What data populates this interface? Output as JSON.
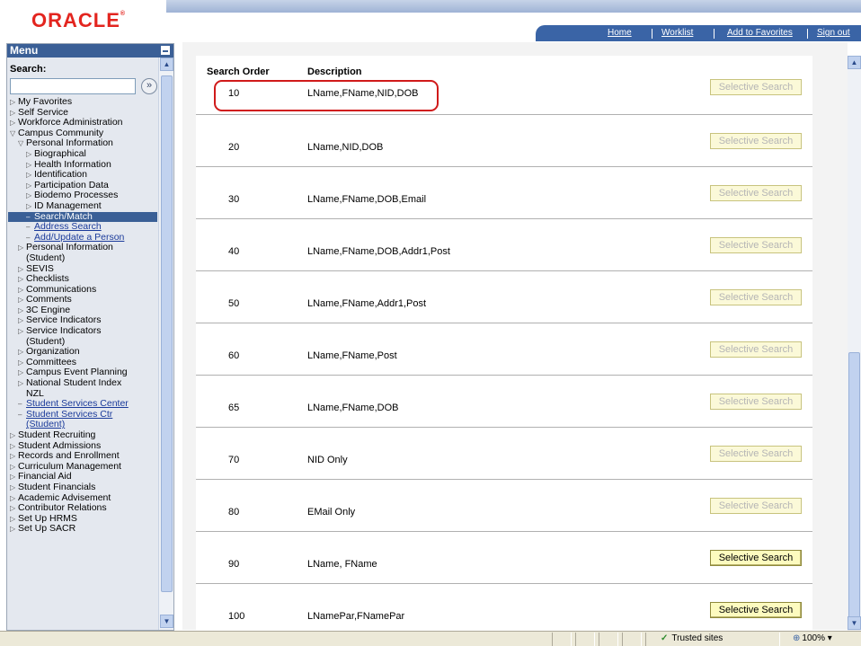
{
  "header": {
    "logo": "ORACLE",
    "nav": [
      "Home",
      "Worklist",
      "Add to Favorites",
      "Sign out"
    ]
  },
  "menu": {
    "title": "Menu",
    "search_label": "Search:",
    "search_value": "",
    "items": [
      {
        "label": "My Favorites",
        "arrow": "▷",
        "indent": 0,
        "type": "item"
      },
      {
        "label": "Self Service",
        "arrow": "▷",
        "indent": 0,
        "type": "item"
      },
      {
        "label": "Workforce Administration",
        "arrow": "▷",
        "indent": 0,
        "type": "item"
      },
      {
        "label": "Campus Community",
        "arrow": "▽",
        "indent": 0,
        "type": "item"
      },
      {
        "label": "Personal Information",
        "arrow": "▽",
        "indent": 1,
        "type": "item"
      },
      {
        "label": "Biographical",
        "arrow": "▷",
        "indent": 2,
        "type": "item"
      },
      {
        "label": "Health Information",
        "arrow": "▷",
        "indent": 2,
        "type": "item"
      },
      {
        "label": "Identification",
        "arrow": "▷",
        "indent": 2,
        "type": "item"
      },
      {
        "label": "Participation Data",
        "arrow": "▷",
        "indent": 2,
        "type": "item"
      },
      {
        "label": "Biodemo Processes",
        "arrow": "▷",
        "indent": 2,
        "type": "item"
      },
      {
        "label": "ID Management",
        "arrow": "▷",
        "indent": 2,
        "type": "item"
      },
      {
        "label": "Search/Match",
        "arrow": "–",
        "indent": 2,
        "type": "selected"
      },
      {
        "label": "Address Search",
        "arrow": "–",
        "indent": 2,
        "type": "link"
      },
      {
        "label": "Add/Update a Person",
        "arrow": "–",
        "indent": 2,
        "type": "link"
      },
      {
        "label": "Personal Information",
        "arrow": "▷",
        "indent": 1,
        "type": "item"
      },
      {
        "label": "(Student)",
        "arrow": "",
        "indent": 1,
        "type": "item"
      },
      {
        "label": "SEVIS",
        "arrow": "▷",
        "indent": 1,
        "type": "item"
      },
      {
        "label": "Checklists",
        "arrow": "▷",
        "indent": 1,
        "type": "item"
      },
      {
        "label": "Communications",
        "arrow": "▷",
        "indent": 1,
        "type": "item"
      },
      {
        "label": "Comments",
        "arrow": "▷",
        "indent": 1,
        "type": "item"
      },
      {
        "label": "3C Engine",
        "arrow": "▷",
        "indent": 1,
        "type": "item"
      },
      {
        "label": "Service Indicators",
        "arrow": "▷",
        "indent": 1,
        "type": "item"
      },
      {
        "label": "Service Indicators",
        "arrow": "▷",
        "indent": 1,
        "type": "item"
      },
      {
        "label": "(Student)",
        "arrow": "",
        "indent": 1,
        "type": "item"
      },
      {
        "label": "Organization",
        "arrow": "▷",
        "indent": 1,
        "type": "item"
      },
      {
        "label": "Committees",
        "arrow": "▷",
        "indent": 1,
        "type": "item"
      },
      {
        "label": "Campus Event Planning",
        "arrow": "▷",
        "indent": 1,
        "type": "item"
      },
      {
        "label": "National Student Index",
        "arrow": "▷",
        "indent": 1,
        "type": "item"
      },
      {
        "label": "NZL",
        "arrow": "",
        "indent": 1,
        "type": "item"
      },
      {
        "label": "Student Services Center",
        "arrow": "–",
        "indent": 1,
        "type": "link"
      },
      {
        "label": "Student Services Ctr",
        "arrow": "–",
        "indent": 1,
        "type": "link"
      },
      {
        "label": "(Student)",
        "arrow": "",
        "indent": 1,
        "type": "link"
      },
      {
        "label": "Student Recruiting",
        "arrow": "▷",
        "indent": 0,
        "type": "item"
      },
      {
        "label": "Student Admissions",
        "arrow": "▷",
        "indent": 0,
        "type": "item"
      },
      {
        "label": "Records and Enrollment",
        "arrow": "▷",
        "indent": 0,
        "type": "item"
      },
      {
        "label": "Curriculum Management",
        "arrow": "▷",
        "indent": 0,
        "type": "item"
      },
      {
        "label": "Financial Aid",
        "arrow": "▷",
        "indent": 0,
        "type": "item"
      },
      {
        "label": "Student Financials",
        "arrow": "▷",
        "indent": 0,
        "type": "item"
      },
      {
        "label": "Academic Advisement",
        "arrow": "▷",
        "indent": 0,
        "type": "item"
      },
      {
        "label": "Contributor Relations",
        "arrow": "▷",
        "indent": 0,
        "type": "item"
      },
      {
        "label": "Set Up HRMS",
        "arrow": "▷",
        "indent": 0,
        "type": "item"
      },
      {
        "label": "Set Up SACR",
        "arrow": "▷",
        "indent": 0,
        "type": "item"
      }
    ]
  },
  "table": {
    "col_order": "Search Order",
    "col_description": "Description",
    "rows": [
      {
        "order": "10",
        "description": "LName,FName,NID,DOB",
        "button": "Selective Search",
        "enabled": false
      },
      {
        "order": "20",
        "description": "LName,NID,DOB",
        "button": "Selective Search",
        "enabled": false
      },
      {
        "order": "30",
        "description": "LName,FName,DOB,Email",
        "button": "Selective Search",
        "enabled": false
      },
      {
        "order": "40",
        "description": "LName,FName,DOB,Addr1,Post",
        "button": "Selective Search",
        "enabled": false
      },
      {
        "order": "50",
        "description": "LName,FName,Addr1,Post",
        "button": "Selective Search",
        "enabled": false
      },
      {
        "order": "60",
        "description": "LName,FName,Post",
        "button": "Selective Search",
        "enabled": false
      },
      {
        "order": "65",
        "description": "LName,FName,DOB",
        "button": "Selective Search",
        "enabled": false
      },
      {
        "order": "70",
        "description": "NID Only",
        "button": "Selective Search",
        "enabled": false
      },
      {
        "order": "80",
        "description": "EMail Only",
        "button": "Selective Search",
        "enabled": false
      },
      {
        "order": "90",
        "description": "LName, FName",
        "button": "Selective Search",
        "enabled": true
      },
      {
        "order": "100",
        "description": "LNamePar,FNamePar",
        "button": "Selective Search",
        "enabled": true
      }
    ]
  },
  "statusbar": {
    "zone": "Trusted sites",
    "zoom": "100%"
  },
  "colors": {
    "brand_red": "#e3251f",
    "nav_blue": "#3a64a6",
    "menu_selected": "#3a5f96",
    "highlight_red": "#d01a1a"
  }
}
